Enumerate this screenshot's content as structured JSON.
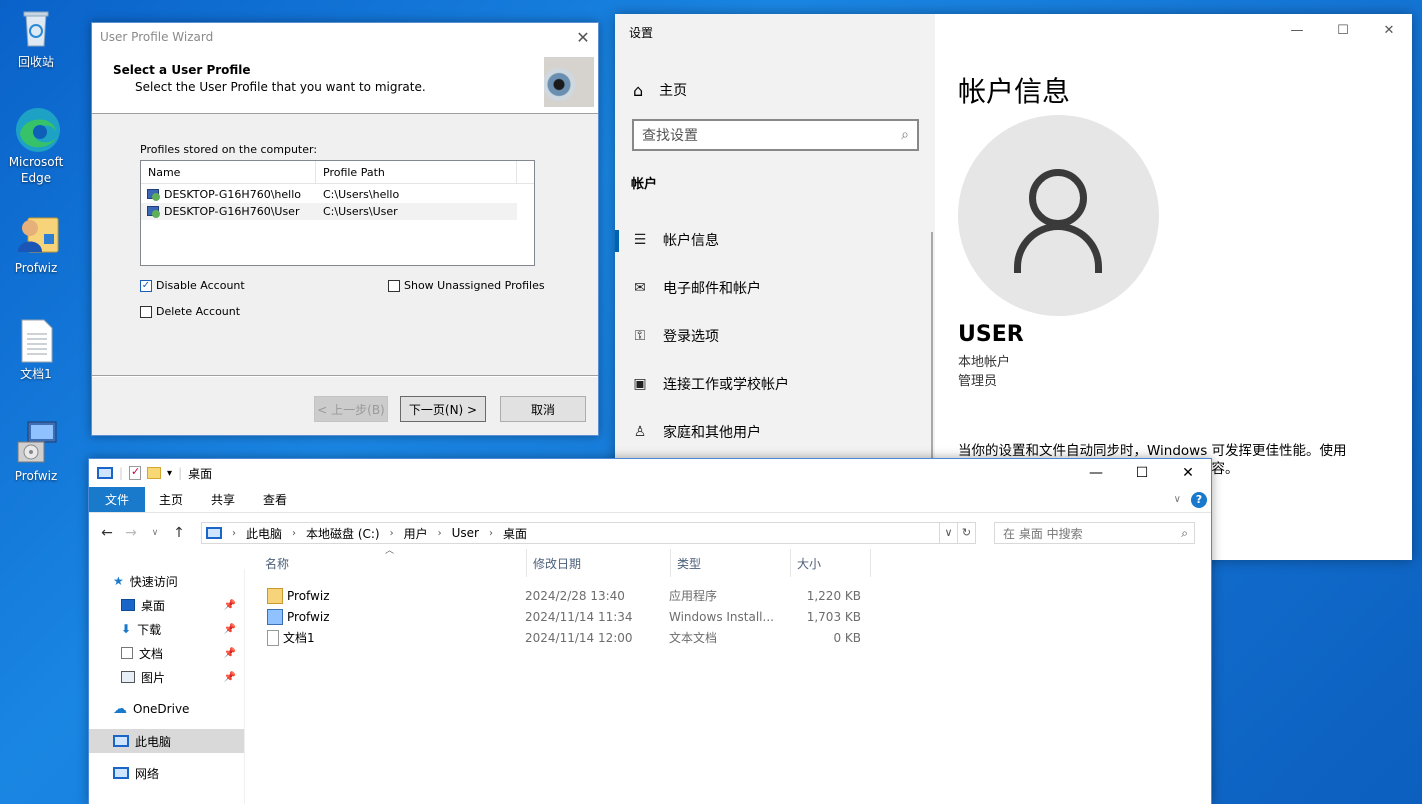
{
  "desktop": {
    "icons": [
      {
        "label": "回收站"
      },
      {
        "label": "Microsoft Edge"
      },
      {
        "label": "Profwiz"
      },
      {
        "label": "文档1"
      },
      {
        "label": "Profwiz"
      }
    ]
  },
  "wizard": {
    "title": "User Profile Wizard",
    "heading": "Select a User Profile",
    "subheading": "Select the User Profile that you want to migrate.",
    "profiles_label": "Profiles stored on the computer:",
    "columns": [
      "Name",
      "Profile Path"
    ],
    "rows": [
      {
        "name": "DESKTOP-G16H760\\hello",
        "path": "C:\\Users\\hello"
      },
      {
        "name": "DESKTOP-G16H760\\User",
        "path": "C:\\Users\\User"
      }
    ],
    "disable_account": "Disable Account",
    "show_unassigned": "Show Unassigned Profiles",
    "delete_account": "Delete Account",
    "back_button": "< 上一步(B)",
    "next_button": "下一页(N) >",
    "cancel_button": "取消"
  },
  "settings": {
    "app_title": "设置",
    "home": "主页",
    "search_placeholder": "查找设置",
    "section": "帐户",
    "nav": [
      {
        "label": "帐户信息",
        "icon": "person-card-icon"
      },
      {
        "label": "电子邮件和帐户",
        "icon": "mail-icon"
      },
      {
        "label": "登录选项",
        "icon": "key-icon"
      },
      {
        "label": "连接工作或学校帐户",
        "icon": "briefcase-icon"
      },
      {
        "label": "家庭和其他用户",
        "icon": "person-add-icon"
      }
    ],
    "page_title": "帐户信息",
    "user_name": "USER",
    "account_type": "本地帐户",
    "account_role": "管理员",
    "sync_text": "当你的设置和文件自动同步时，Windows 可发挥更佳性能。使用",
    "sync_text_2": "内容。"
  },
  "explorer": {
    "title": "桌面",
    "ribbon_tabs": [
      "文件",
      "主页",
      "共享",
      "查看"
    ],
    "breadcrumb": [
      "此电脑",
      "本地磁盘 (C:)",
      "用户",
      "User",
      "桌面"
    ],
    "search_placeholder": "在 桌面 中搜索",
    "sidebar": [
      {
        "label": "快速访问",
        "pinned": false
      },
      {
        "label": "桌面",
        "pinned": true
      },
      {
        "label": "下载",
        "pinned": true
      },
      {
        "label": "文档",
        "pinned": true
      },
      {
        "label": "图片",
        "pinned": true
      },
      {
        "label": "OneDrive",
        "pinned": false
      },
      {
        "label": "此电脑",
        "pinned": false
      },
      {
        "label": "网络",
        "pinned": false
      }
    ],
    "columns": [
      "名称",
      "修改日期",
      "类型",
      "大小"
    ],
    "files": [
      {
        "name": "Profwiz",
        "date": "2024/2/28 13:40",
        "type": "应用程序",
        "size": "1,220 KB"
      },
      {
        "name": "Profwiz",
        "date": "2024/11/14 11:34",
        "type": "Windows Install...",
        "size": "1,703 KB"
      },
      {
        "name": "文档1",
        "date": "2024/11/14 12:00",
        "type": "文本文档",
        "size": "0 KB"
      }
    ]
  }
}
